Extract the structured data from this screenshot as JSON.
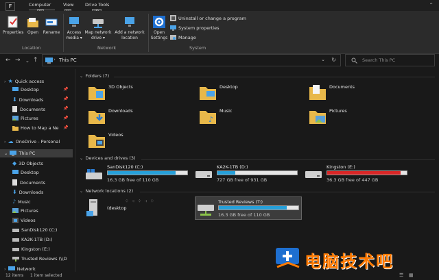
{
  "tabs": {
    "file": "F",
    "computer": "Computer",
    "computer_key": "C",
    "view": "View",
    "view_key": "V",
    "drive_tools": "Drive Tools",
    "drive_tools_key": "JD"
  },
  "ribbon": {
    "properties": "Properties",
    "open": "Open",
    "rename": "Rename",
    "location_group": "Location",
    "access_media": "Access",
    "access_media2": "media",
    "map_network": "Map network",
    "map_network2": "drive",
    "add_network": "Add a network",
    "add_network2": "location",
    "network_group": "Network",
    "open_settings": "Open",
    "open_settings2": "Settings",
    "uninstall": "Uninstall or change a program",
    "system_properties": "System properties",
    "manage": "Manage",
    "system_group": "System"
  },
  "address": {
    "path": "This PC",
    "search_placeholder": "Search This PC"
  },
  "sidebar": {
    "quick_access": "Quick access",
    "items": [
      "Desktop",
      "Downloads",
      "Documents",
      "Pictures",
      "How to Map a Ne"
    ],
    "onedrive": "OneDrive - Personal",
    "this_pc": "This PC",
    "pc_items": [
      "3D Objects",
      "Desktop",
      "Documents",
      "Downloads",
      "Music",
      "Pictures",
      "Videos",
      "SanDisk120 (C:)",
      "KA2K-1TB (D:)",
      "Kingston (E:)",
      "Trusted Reviews (\\\\D"
    ],
    "network": "Network"
  },
  "folders": {
    "header": "Folders (7)",
    "items": [
      "3D Objects",
      "Desktop",
      "Documents",
      "Downloads",
      "Music",
      "Pictures",
      "Videos"
    ]
  },
  "drives": {
    "header": "Devices and drives (3)",
    "items": [
      {
        "name": "SanDisk120 (C:)",
        "free": "16.3 GB free of 110 GB",
        "used_fraction": 0.85,
        "color": "#26a0da"
      },
      {
        "name": "KA2K-1TB (D:)",
        "free": "727 GB free of 931 GB",
        "used_fraction": 0.22,
        "color": "#26a0da"
      },
      {
        "name": "Kingston (E:)",
        "free": "36.3 GB free of 447 GB",
        "used_fraction": 0.92,
        "color": "#da2626"
      }
    ]
  },
  "network_locations": {
    "header": "Network locations (2)",
    "items": [
      {
        "name": "(desktop",
        "free": ""
      },
      {
        "name": "Trusted Reviews (T:)",
        "free": "16.3 GB free of 110 GB",
        "used_fraction": 0.85,
        "color": "#26a0da"
      }
    ]
  },
  "status": {
    "count": "12 items",
    "selected": "1 item selected"
  },
  "watermark": {
    "text": "电脑技术吧"
  }
}
